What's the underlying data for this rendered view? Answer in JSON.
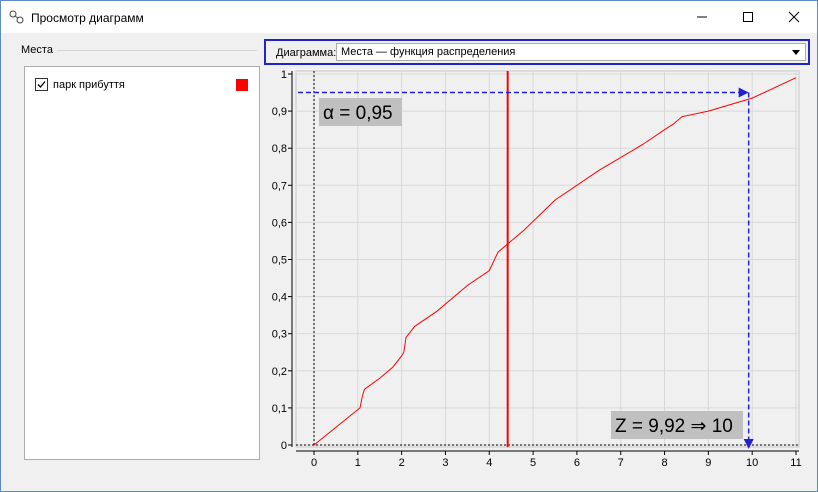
{
  "window": {
    "title": "Просмотр диаграмм"
  },
  "left_panel": {
    "title": "Места",
    "items": [
      {
        "label": "парк прибуття",
        "checked": true,
        "color": "#ff0000"
      }
    ]
  },
  "diagram_selector": {
    "label": "Диаграмма:",
    "value": "Места — функция распределения"
  },
  "chart_data": {
    "type": "line",
    "title": "",
    "xlabel": "",
    "ylabel": "",
    "xlim": [
      0,
      11
    ],
    "ylim": [
      0,
      1
    ],
    "x_ticks": [
      "0",
      "1",
      "2",
      "3",
      "4",
      "5",
      "6",
      "7",
      "8",
      "9",
      "10",
      "11"
    ],
    "y_ticks": [
      "0",
      "0,1",
      "0,2",
      "0,3",
      "0,4",
      "0,5",
      "0,6",
      "0,7",
      "0,8",
      "0,9",
      "1"
    ],
    "grid": true,
    "series": [
      {
        "color": "#ff0000",
        "x": [
          0,
          1.05,
          1.1,
          1.15,
          1.5,
          1.8,
          2.0,
          2.05,
          2.1,
          2.3,
          2.8,
          3.5,
          4.0,
          4.2,
          4.8,
          5.5,
          6.5,
          7.5,
          8.0,
          8.2,
          8.4,
          9.0,
          10.0,
          11.0
        ],
        "y": [
          0,
          0.1,
          0.13,
          0.15,
          0.18,
          0.21,
          0.24,
          0.25,
          0.29,
          0.32,
          0.36,
          0.43,
          0.47,
          0.52,
          0.58,
          0.66,
          0.74,
          0.81,
          0.85,
          0.865,
          0.885,
          0.9,
          0.935,
          0.99
        ]
      }
    ],
    "vertical_marker": {
      "x": 4.42,
      "color": "#ff0000"
    },
    "annotations": {
      "alpha_text": "α = 0,95",
      "alpha_y": 0.95,
      "z_text": "Z = 9,92 ⇒ 10",
      "z_x": 9.92,
      "arrow_color": "#2222cc"
    }
  }
}
